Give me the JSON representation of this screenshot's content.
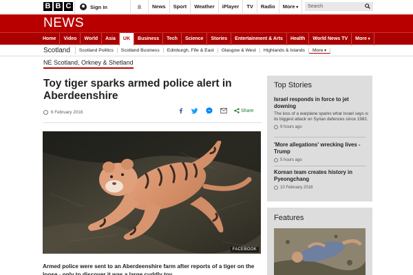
{
  "brand": {
    "letters": [
      "B",
      "B",
      "C"
    ],
    "news": "NEWS"
  },
  "masthead": {
    "signin_label": "Sign in",
    "nav": [
      "News",
      "Sport",
      "Weather",
      "iPlayer",
      "TV",
      "Radio",
      "More"
    ],
    "search_placeholder": "Search"
  },
  "sections": {
    "items": [
      "Home",
      "Video",
      "World",
      "Asia",
      "UK",
      "Business",
      "Tech",
      "Science",
      "Stories",
      "Entertainment & Arts",
      "Health",
      "World News TV",
      "More"
    ],
    "active": "UK"
  },
  "subnav": {
    "section": "Scotland",
    "items": [
      "Scotland Politics",
      "Scotland Business",
      "Edinburgh, Fife & East",
      "Glasgow & West",
      "Highlands & Islands",
      "More"
    ]
  },
  "region": "NE Scotland, Orkney & Shetland",
  "article": {
    "headline": "Toy tiger sparks armed police alert in Aberdeenshire",
    "date": "6 February 2018",
    "share_label": "Share",
    "image_credit": "FACEBOOK",
    "body": "Armed police were sent to an Aberdeenshire farm after reports of a tiger on the loose - only to discover it was a large cuddly toy."
  },
  "sidebar": {
    "top_stories_title": "Top Stories",
    "stories": [
      {
        "headline": "Israel responds in force to jet downing",
        "summary": "The loss of a warplane sparks what Israel says is its biggest attack on Syrian defences since 1982.",
        "time": "9 hours ago"
      },
      {
        "headline": "'More allegations' wrecking lives - Trump",
        "summary": "",
        "time": "5 hours ago"
      },
      {
        "headline": "Korean team creates history in Pyeongchang",
        "summary": "",
        "time": "10 February 2018"
      }
    ],
    "features_title": "Features"
  },
  "colors": {
    "brand_red": "#b80000",
    "share_green": "#1b7d2e",
    "panel_grey": "#dddddd"
  }
}
